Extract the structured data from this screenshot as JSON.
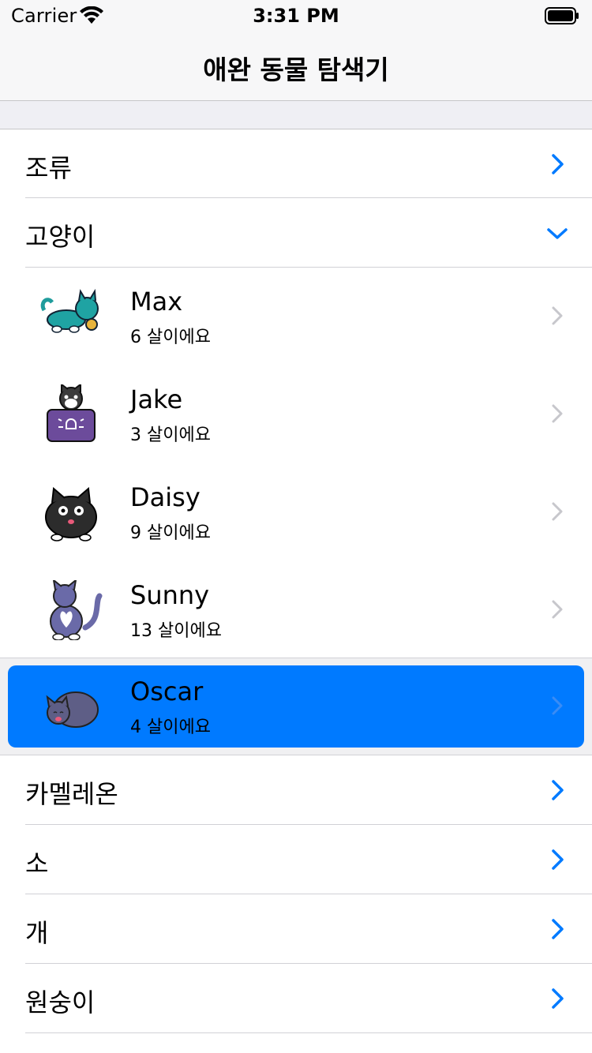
{
  "status_bar": {
    "carrier": "Carrier",
    "time": "3:31 PM"
  },
  "nav": {
    "title": "애완 동물 탐색기"
  },
  "categories_top": [
    {
      "label": "조류",
      "expanded": false
    },
    {
      "label": "고양이",
      "expanded": true
    }
  ],
  "cats": [
    {
      "name": "Max",
      "age": "6 살이에요"
    },
    {
      "name": "Jake",
      "age": "3 살이에요"
    },
    {
      "name": "Daisy",
      "age": "9 살이에요"
    },
    {
      "name": "Sunny",
      "age": "13 살이에요"
    },
    {
      "name": "Oscar",
      "age": "4 살이에요",
      "selected": true
    }
  ],
  "categories_bottom": [
    {
      "label": "카멜레온"
    },
    {
      "label": "소"
    },
    {
      "label": "개"
    },
    {
      "label": "원숭이"
    }
  ],
  "colors": {
    "accent": "#007aff",
    "chevron_gray": "#c7c7cc"
  }
}
